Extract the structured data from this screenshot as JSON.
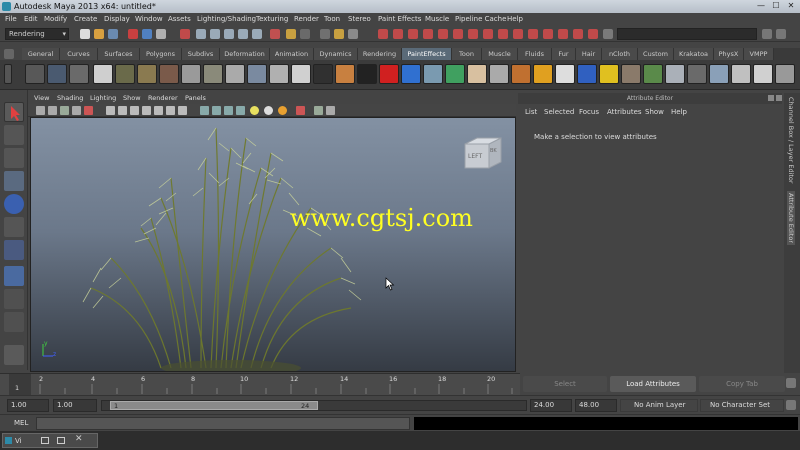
{
  "window": {
    "title": "Autodesk Maya 2013 x64: untitled*",
    "controls": [
      "—",
      "☐",
      "✕"
    ]
  },
  "menubar": {
    "items": [
      "File",
      "Edit",
      "Modify",
      "Create",
      "Display",
      "Window",
      "Assets",
      "Lighting/Shading",
      "Texturing",
      "Render",
      "Toon",
      "Stereo",
      "Paint Effects",
      "Muscle",
      "Pipeline Cache",
      "Help"
    ]
  },
  "statusline": {
    "menu_set": "Rendering"
  },
  "shelf": {
    "tabs": [
      "General",
      "Curves",
      "Surfaces",
      "Polygons",
      "Subdivs",
      "Deformation",
      "Animation",
      "Dynamics",
      "Rendering",
      "PaintEffects",
      "Toon",
      "Muscle",
      "Fluids",
      "Fur",
      "Hair",
      "nCloth",
      "Custom",
      "Krakatoa",
      "PhysX",
      "VMPP"
    ],
    "active_tab": "PaintEffects"
  },
  "viewport": {
    "menu": [
      "View",
      "Shading",
      "Lighting",
      "Show",
      "Renderer",
      "Panels"
    ],
    "viewcube": {
      "left": "LEFT",
      "back": "BK"
    },
    "watermark": "www.cgtsj.com",
    "axis": {
      "y": "y",
      "z": "z"
    }
  },
  "attribute_editor": {
    "title": "Attribute Editor",
    "menu": [
      "List",
      "Selected",
      "Focus",
      "Attributes",
      "Show",
      "Help"
    ],
    "message": "Make a selection to view attributes",
    "buttons": {
      "select": "Select",
      "load": "Load Attributes",
      "copy": "Copy Tab"
    }
  },
  "side_tabs": [
    "Channel Box / Layer Editor",
    "Attribute Editor"
  ],
  "timeline": {
    "ticks": [
      "2",
      "4",
      "6",
      "8",
      "10",
      "12",
      "14",
      "16",
      "18",
      "20"
    ],
    "current_frame": "1"
  },
  "range_slider": {
    "start": "1.00",
    "playback_start": "1.00",
    "range_label_start": "1",
    "range_label_end": "24",
    "playback_end": "24.00",
    "end": "48.00",
    "anim_layer": "No Anim Layer",
    "character_set": "No Character Set"
  },
  "command_line": {
    "label": "MEL"
  },
  "taskbar": {
    "item": "Vi"
  },
  "colors": {
    "background": "#444444",
    "accent": "#5a6a78",
    "watermark": "#ffff22"
  }
}
